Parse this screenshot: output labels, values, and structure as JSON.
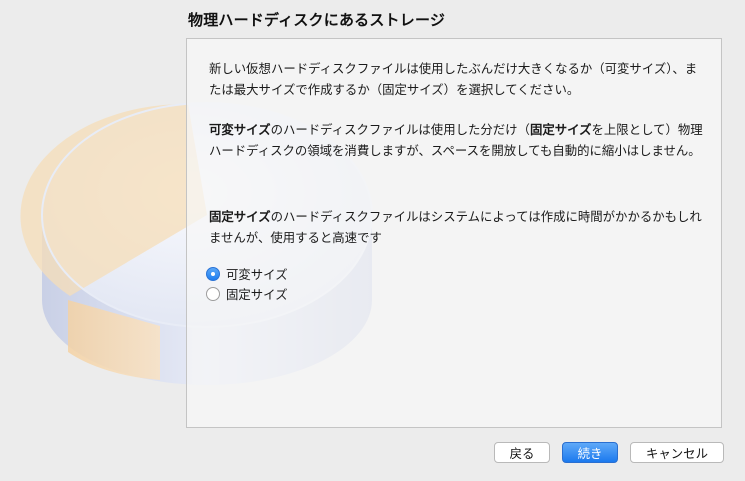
{
  "dialog": {
    "title": "物理ハードディスクにあるストレージ",
    "paragraphs": {
      "p1": "新しい仮想ハードディスクファイルは使用したぶんだけ大きくなるか（可変サイズ）、または最大サイズで作成するか（固定サイズ）を選択してください。",
      "p2_bold1": "可変サイズ",
      "p2_text1": "のハードディスクファイルは使用した分だけ（",
      "p2_bold2": "固定サイズ",
      "p2_text2": "を上限として）物理ハードディスクの領域を消費しますが、スペースを開放しても自動的に縮小はしません。",
      "p3_bold": "固定サイズ",
      "p3_text": "のハードディスクファイルはシステムによっては作成に時間がかかるかもしれませんが、使用すると高速です"
    },
    "options": {
      "dynamic": {
        "label": "可変サイズ",
        "selected": true
      },
      "fixed": {
        "label": "固定サイズ",
        "selected": false
      }
    },
    "buttons": {
      "back": "戻る",
      "next": "続き",
      "cancel": "キャンセル"
    }
  },
  "colors": {
    "accent": "#1f7ef0",
    "background": "#ececec"
  },
  "icons": {
    "background_art": "hard-disk-illustration"
  }
}
